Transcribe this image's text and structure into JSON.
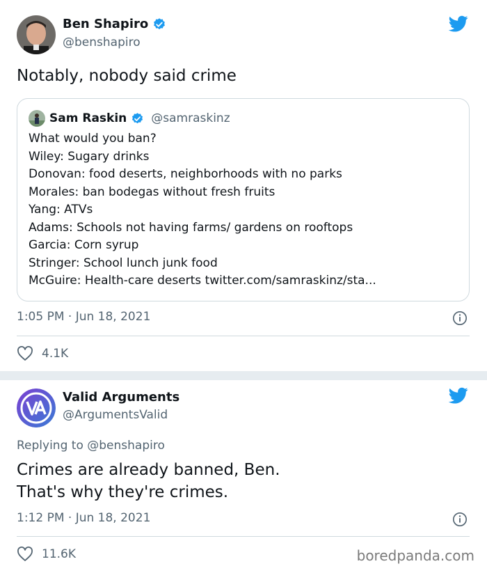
{
  "colors": {
    "twitter_blue": "#1d9bf0",
    "text": "#0f1419",
    "muted": "#536471",
    "border": "#cfd9de"
  },
  "tweet1": {
    "author_name": "Ben Shapiro",
    "author_handle": "@benshapiro",
    "text": "Notably, nobody said crime",
    "quote": {
      "author_name": "Sam Raskin",
      "author_handle": "@samraskinz",
      "lines": [
        "What would you ban?",
        "Wiley: Sugary drinks",
        "Donovan: food deserts, neighborhoods with no parks",
        "Morales: ban bodegas without fresh fruits",
        "Yang: ATVs",
        "Adams: Schools not having farms/ gardens on rooftops",
        "Garcia: Corn syrup",
        "Stringer: School lunch junk food",
        "McGuire: Health-care deserts twitter.com/samraskinz/sta..."
      ]
    },
    "timestamp": "1:05 PM · Jun 18, 2021",
    "likes": "4.1K"
  },
  "tweet2": {
    "author_name": "Valid Arguments",
    "author_handle": "@ArgumentsValid",
    "replying_to": "Replying to @benshapiro",
    "text_lines": [
      "Crimes are already banned, Ben.",
      "That's why they're crimes."
    ],
    "timestamp": "1:12 PM · Jun 18, 2021",
    "likes": "11.6K"
  },
  "watermark": "boredpanda.com",
  "icons": [
    "twitter-bird-icon",
    "verified-badge-icon",
    "info-icon",
    "heart-icon"
  ]
}
